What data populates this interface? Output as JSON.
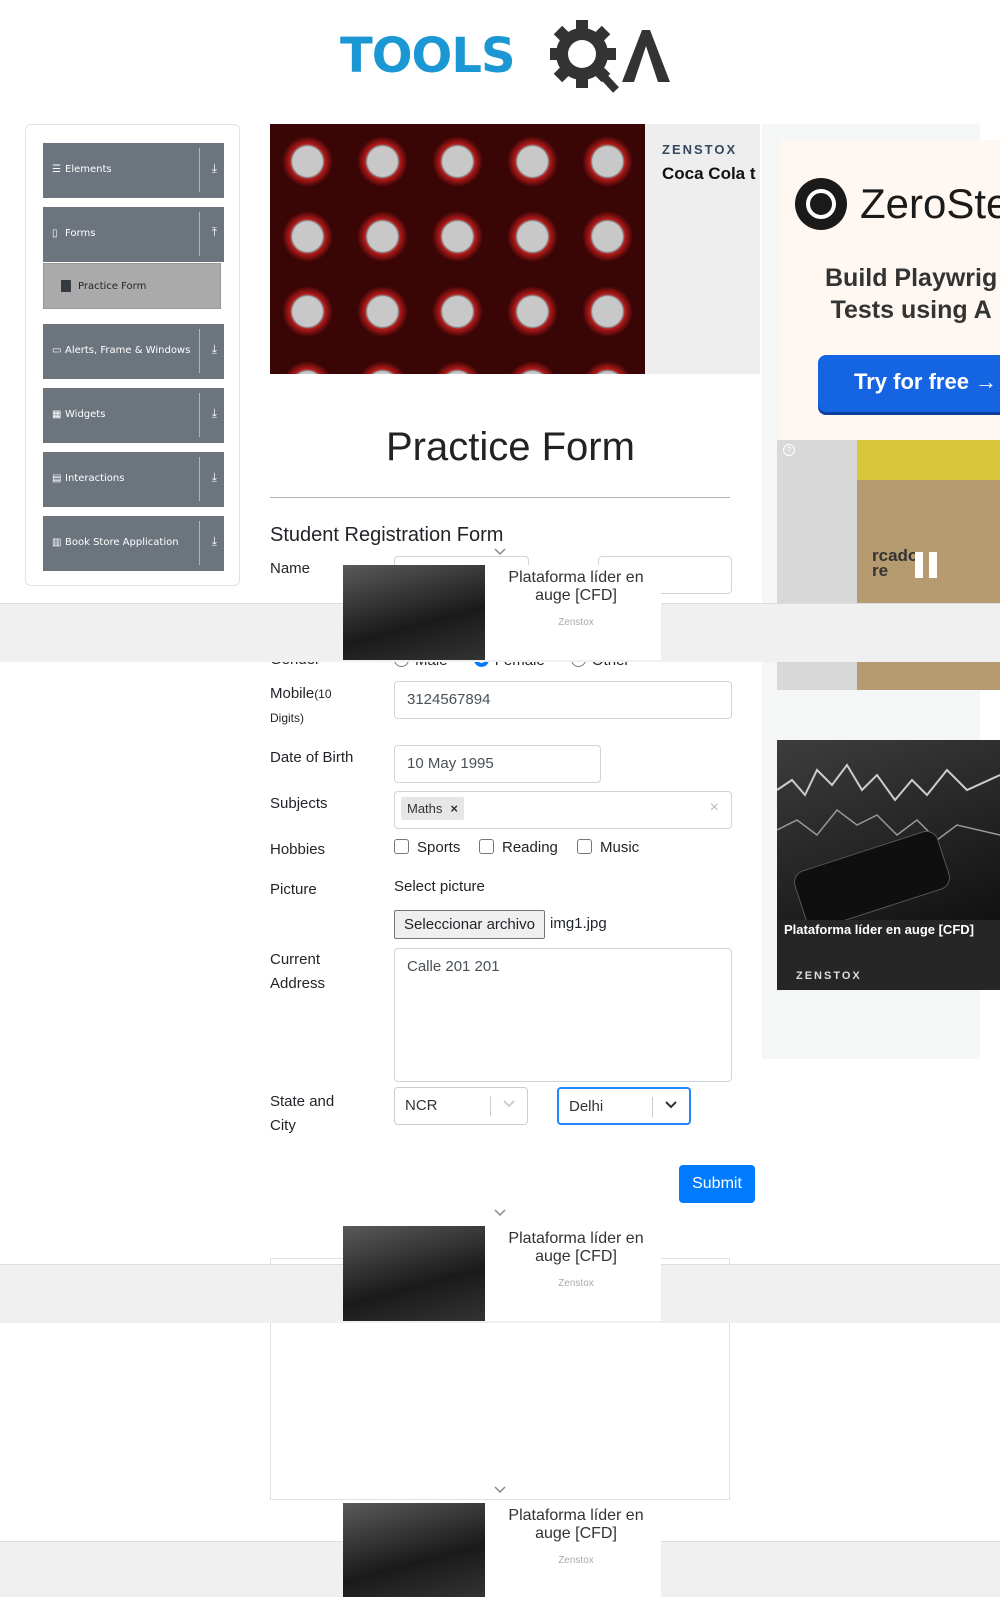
{
  "header": {
    "logo_text": "TOOLS",
    "logo_text_2": "QA"
  },
  "sidebar": {
    "groups": [
      {
        "label": "Elements",
        "icon": "list-icon",
        "arrow": "expand-down-icon"
      },
      {
        "label": "Forms",
        "icon": "forms-icon",
        "arrow": "collapse-up-icon"
      },
      {
        "label": "Alerts, Frame & Windows",
        "icon": "window-icon",
        "arrow": "expand-down-icon"
      },
      {
        "label": "Widgets",
        "icon": "widgets-icon",
        "arrow": "expand-down-icon"
      },
      {
        "label": "Interactions",
        "icon": "interactions-icon",
        "arrow": "expand-down-icon"
      },
      {
        "label": "Book Store Application",
        "icon": "book-icon",
        "arrow": "expand-down-icon"
      }
    ],
    "active_item": "Practice Form"
  },
  "banner": {
    "brand": "ZENSTOX",
    "title": "Coca Cola t"
  },
  "right_ads": {
    "zero": {
      "name": "ZeroSte",
      "line1": "Build Playwrig",
      "line2": "Tests using A",
      "button": "Try for free →"
    },
    "video": {
      "label": "rcado\nre"
    },
    "cfd": {
      "title": "Plataforma líder en auge [CFD]",
      "brand": "ZENSTOX"
    }
  },
  "form": {
    "page_title": "Practice Form",
    "heading": "Student Registration Form",
    "labels": {
      "name": "Name",
      "gender": "Gender",
      "mobile": "Mobile",
      "mobile_hint": "(10",
      "mobile_hint2": "Digits)",
      "dob": "Date of Birth",
      "subjects": "Subjects",
      "hobbies": "Hobbies",
      "picture": "Picture",
      "address1": "Current",
      "address2": "Address",
      "state1": "State and",
      "state2": "City"
    },
    "gender_options": [
      "Male",
      "Female",
      "Other"
    ],
    "gender_selected": "Female",
    "mobile_value": "3124567894",
    "dob_value": "10 May 1995",
    "subjects": [
      "Maths"
    ],
    "hobbies": [
      "Sports",
      "Reading",
      "Music"
    ],
    "picture_label": "Select picture",
    "file_button": "Seleccionar archivo",
    "file_name": "img1.jpg",
    "address_value": "Calle 201 201",
    "state_value": "NCR",
    "city_value": "Delhi",
    "submit": "Submit"
  },
  "popup_ad": {
    "text": "Plataforma líder en auge [CFD]",
    "brand": "Zenstox"
  },
  "colors": {
    "accent": "#007bff",
    "sidebar": "#6c757d",
    "logo_blue": "#1b98d3"
  }
}
